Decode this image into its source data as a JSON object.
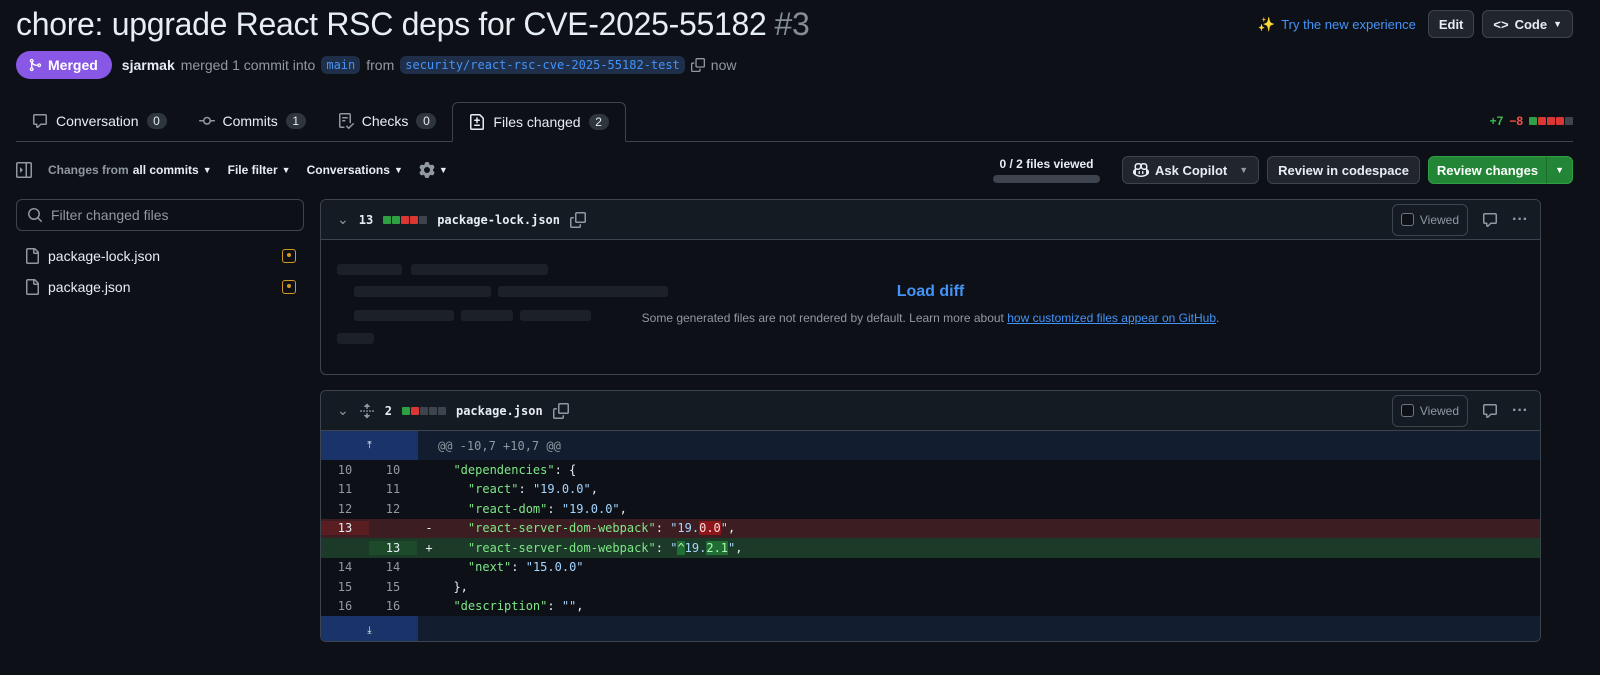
{
  "header": {
    "title": "chore: upgrade React RSC deps for CVE-2025-55182",
    "number": "#3",
    "try_new": "Try the new experience",
    "edit_label": "Edit",
    "code_label": "Code"
  },
  "meta": {
    "status": "Merged",
    "author": "sjarmak",
    "action": "merged 1 commit into",
    "base_branch": "main",
    "from_word": "from",
    "head_branch": "security/react-rsc-cve-2025-55182-test",
    "time": "now"
  },
  "tabs": [
    {
      "label": "Conversation",
      "count": "0",
      "icon": "comment-icon"
    },
    {
      "label": "Commits",
      "count": "1",
      "icon": "commit-icon"
    },
    {
      "label": "Checks",
      "count": "0",
      "icon": "checklist-icon"
    },
    {
      "label": "Files changed",
      "count": "2",
      "icon": "file-diff-icon"
    }
  ],
  "active_tab": "Files changed",
  "diffstat": {
    "additions": "+7",
    "deletions": "−8",
    "blocks": [
      "g",
      "r",
      "r",
      "r",
      "n"
    ]
  },
  "toolbar": {
    "changes_from_prefix": "Changes from",
    "changes_from_value": "all commits",
    "file_filter": "File filter",
    "conversations": "Conversations",
    "viewed_text": "0 / 2 files viewed",
    "viewed_progress": 0,
    "ask_copilot": "Ask Copilot",
    "codespace": "Review in codespace",
    "review_changes": "Review changes"
  },
  "sidebar": {
    "filter_placeholder": "Filter changed files",
    "files": [
      {
        "name": "package-lock.json"
      },
      {
        "name": "package.json"
      }
    ]
  },
  "files": [
    {
      "count": "13",
      "name": "package-lock.json",
      "blocks": [
        "g",
        "g",
        "r",
        "r",
        "n"
      ],
      "viewed_label": "Viewed",
      "load_diff": "Load diff",
      "note_prefix": "Some generated files are not rendered by default. Learn more about ",
      "note_link": "how customized files appear on GitHub",
      "note_suffix": "."
    },
    {
      "count": "2",
      "name": "package.json",
      "blocks": [
        "g",
        "r",
        "n",
        "n",
        "n"
      ],
      "viewed_label": "Viewed",
      "hunk": "@@ -10,7 +10,7 @@"
    }
  ],
  "diff_lines": [
    {
      "type": "ctx",
      "old": "10",
      "new": "10",
      "sign": "",
      "indent": "  ",
      "key": "\"dependencies\"",
      "rest": ": {"
    },
    {
      "type": "ctx",
      "old": "11",
      "new": "11",
      "sign": "",
      "indent": "    ",
      "key": "\"react\"",
      "rest": ": ",
      "value": "\"19.0.0\"",
      "tail": ","
    },
    {
      "type": "ctx",
      "old": "12",
      "new": "12",
      "sign": "",
      "indent": "    ",
      "key": "\"react-dom\"",
      "rest": ": ",
      "value": "\"19.0.0\"",
      "tail": ","
    },
    {
      "type": "del",
      "old": "13",
      "new": "",
      "sign": "-",
      "indent": "    ",
      "key": "\"react-server-dom-webpack\"",
      "rest": ": ",
      "value_pre": "\"19.",
      "value_hl": "0.0",
      "value_post": "\"",
      "tail": ","
    },
    {
      "type": "add",
      "old": "",
      "new": "13",
      "sign": "+",
      "indent": "    ",
      "key": "\"react-server-dom-webpack\"",
      "rest": ": ",
      "value_pre": "\"",
      "value_hl0": "^",
      "value_mid": "19.",
      "value_hl": "2.1",
      "value_post": "\"",
      "tail": ","
    },
    {
      "type": "ctx",
      "old": "14",
      "new": "14",
      "sign": "",
      "indent": "    ",
      "key": "\"next\"",
      "rest": ": ",
      "value": "\"15.0.0\""
    },
    {
      "type": "ctx",
      "old": "15",
      "new": "15",
      "sign": "",
      "indent": "  ",
      "key": "",
      "rest": "},"
    },
    {
      "type": "ctx",
      "old": "16",
      "new": "16",
      "sign": "",
      "indent": "  ",
      "key": "\"description\"",
      "rest": ": ",
      "value": "\"\"",
      "tail": ","
    }
  ],
  "colors": {
    "background": "#0d1117",
    "accent": "#4493f8",
    "merged": "#8957e5",
    "green": "#238636",
    "red": "#da3633"
  }
}
